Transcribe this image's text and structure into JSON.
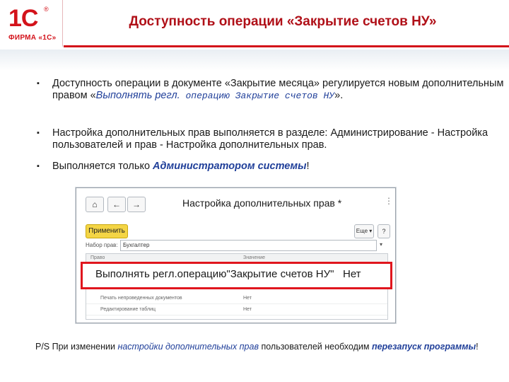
{
  "logo": {
    "mark": "1С",
    "registered": "®",
    "firm": "ФИРМА «1С»"
  },
  "title": "Доступность операции «Закрытие счетов НУ»",
  "bullets": [
    {
      "marker": "▪",
      "part1": "Доступность операции в документе «Закрытие месяца» регулируется новым дополнительным правом «",
      "emph": "Выполнять регл.",
      "emph_mono": " операцию Закрытие счетов НУ",
      "part2": "»."
    },
    {
      "marker": "▪",
      "text": "Настройка дополнительных прав выполняется в разделе: Администрирование - Настройка пользователей и прав - Настройка дополнительных прав."
    },
    {
      "marker": "▪",
      "part1": "Выполняется только ",
      "emph": "Администратором системы",
      "part2": "!"
    }
  ],
  "screenshot": {
    "home_icon": "⌂",
    "back_icon": "←",
    "forward_icon": "→",
    "window_title": "Настройка дополнительных прав *",
    "more_icon": "⋮",
    "apply_label": "Применить",
    "more_label": "Еще ▾",
    "help_label": "?",
    "set_label": "Набор прав:",
    "set_value": "Бухгалтер",
    "set_drop": "▾",
    "col_right": "Право",
    "col_value": "Значение",
    "rows": [
      {
        "right": "Печать непроведенных документов",
        "value": "Нет"
      },
      {
        "right": "Редактирование таблиц",
        "value": "Нет"
      }
    ],
    "highlight_row": {
      "right": "Выполнять регл.операцию\"Закрытие счетов НУ\"",
      "value": "Нет"
    }
  },
  "note": {
    "part1": "P/S При изменении ",
    "emph1": "настройки дополнительных прав",
    "part2": " пользователей необходим ",
    "emph2": "перезапуск программы",
    "part3": "!"
  },
  "colors": {
    "brand_red": "#d3121a",
    "title_red": "#b01018",
    "emph_blue": "#21409a",
    "highlight_border": "#e0161e",
    "apply_yellow": "#f4d545"
  }
}
